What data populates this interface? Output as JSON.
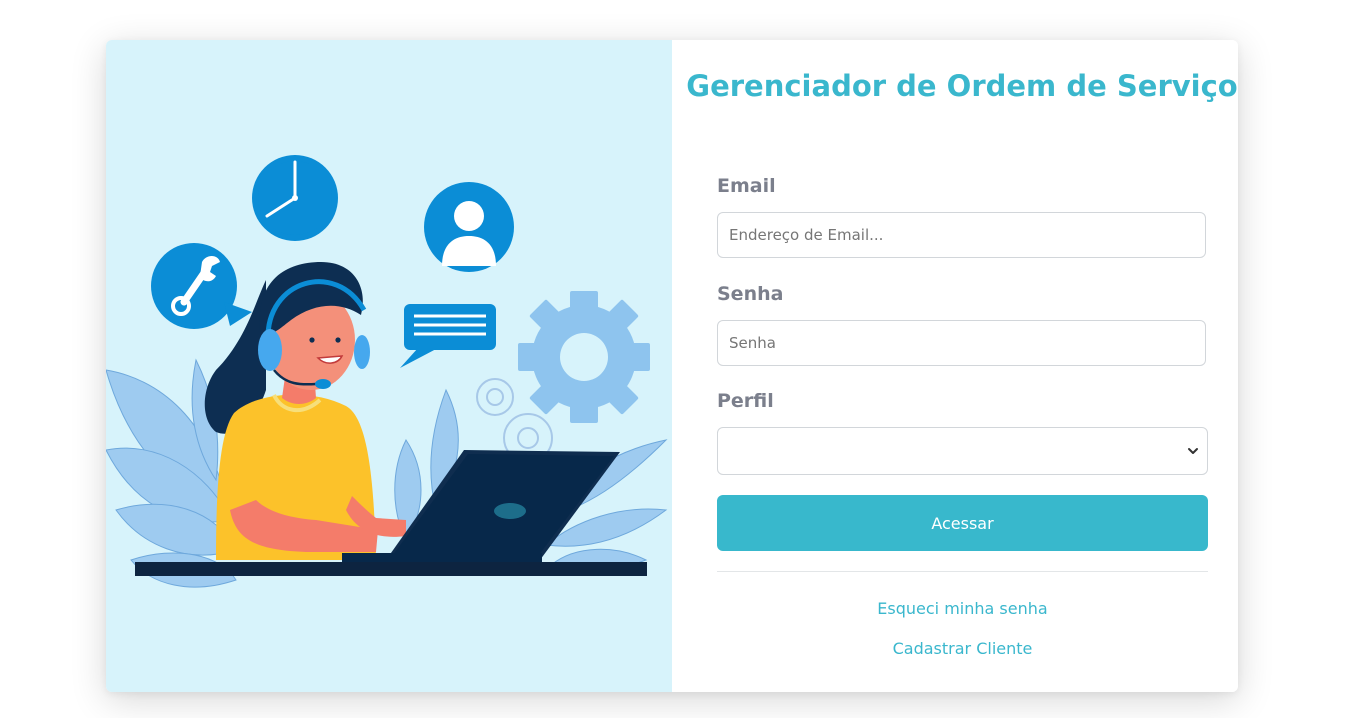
{
  "title": "Gerenciador de Ordem de Serviço",
  "form": {
    "email_label": "Email",
    "email_placeholder": "Endereço de Email...",
    "password_label": "Senha",
    "password_placeholder": "Senha",
    "profile_label": "Perfil",
    "profile_selected": "",
    "submit_label": "Acessar"
  },
  "links": {
    "forgot_password": "Esqueci minha senha",
    "register_client": "Cadastrar Cliente"
  },
  "icons": {
    "illustration": "support-agent-illustration",
    "clock": "clock-icon",
    "user": "user-icon",
    "wrench": "wrench-icon",
    "chat": "chat-bubble-icon",
    "gear": "gear-icon",
    "select_arrow": "chevron-down-icon"
  },
  "colors": {
    "accent": "#38b8cc",
    "illustration_bg": "#d7f3fb",
    "label": "#7b7f8c"
  }
}
